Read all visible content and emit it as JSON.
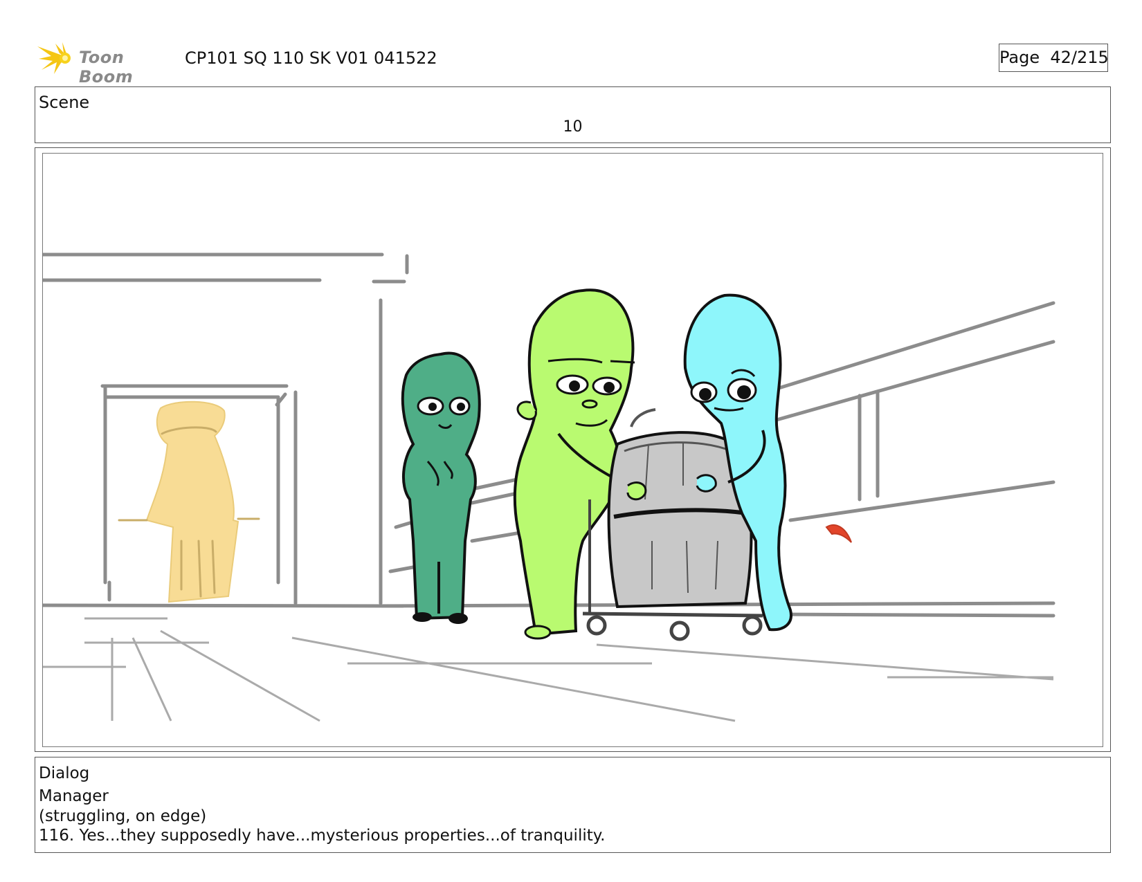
{
  "header": {
    "logo_text": "Toon Boom",
    "logo_icon": "starburst-icon",
    "doc_title": "CP101 SQ 110 SK V01 041522",
    "page_label": "Page  42/215"
  },
  "scene": {
    "label": "Scene",
    "number": "10"
  },
  "panel": {
    "description_icon": "storyboard-sketch",
    "colors": {
      "yellow_figure": "#f8dc95",
      "dark_green_figure": "#4fae87",
      "lime_figure": "#b9fa70",
      "cyan_figure": "#8ef6fb",
      "barrel": "#c8c8c8",
      "accent_red": "#e2452a"
    }
  },
  "dialog": {
    "label": "Dialog",
    "character": "Manager",
    "direction": "(struggling, on edge)",
    "line": "116. Yes...they supposedly have...mysterious properties...of tranquility."
  }
}
